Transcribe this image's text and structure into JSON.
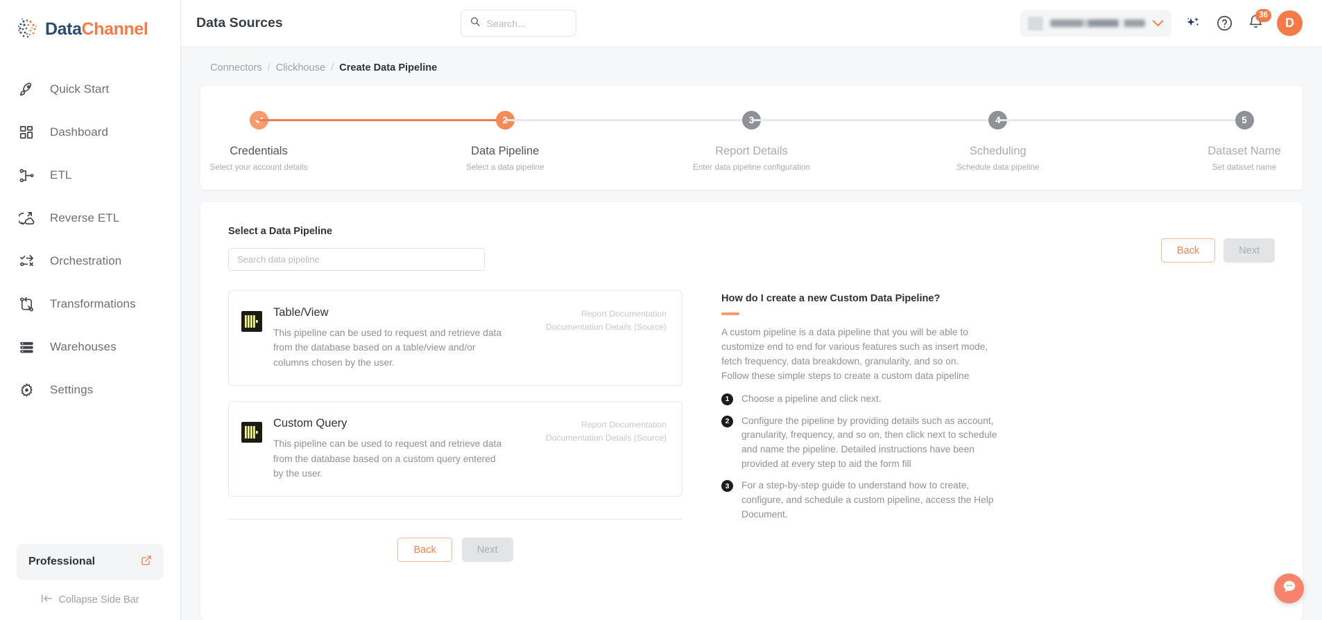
{
  "brand": {
    "name_first": "Data",
    "name_second": "Channel",
    "color_primary": "#f47b45",
    "color_dark": "#2b4a6f"
  },
  "sidebar": {
    "items": [
      {
        "label": "Quick Start",
        "icon": "rocket-icon"
      },
      {
        "label": "Dashboard",
        "icon": "grid-icon"
      },
      {
        "label": "ETL",
        "icon": "etl-icon"
      },
      {
        "label": "Reverse ETL",
        "icon": "reverse-etl-icon"
      },
      {
        "label": "Orchestration",
        "icon": "orchestration-icon"
      },
      {
        "label": "Transformations",
        "icon": "transformations-icon"
      },
      {
        "label": "Warehouses",
        "icon": "warehouses-icon"
      },
      {
        "label": "Settings",
        "icon": "gear-icon"
      }
    ],
    "plan": {
      "label": "Professional",
      "icon": "external-link-icon"
    },
    "collapse": {
      "label": "Collapse Side Bar",
      "icon": "collapse-left-icon"
    }
  },
  "header": {
    "title": "Data Sources",
    "search": {
      "placeholder": "Search...",
      "value": "",
      "icon": "search-icon"
    },
    "account": {
      "name": "",
      "redacted": true,
      "chevron": "chevron-down-icon"
    },
    "sparkle_icon": "sparkle-ai-icon",
    "help_icon": "help-circle-icon",
    "notifications": {
      "icon": "bell-icon",
      "count": "36"
    },
    "avatar": {
      "initial": "D"
    }
  },
  "breadcrumb": {
    "items": [
      "Connectors",
      "Clickhouse"
    ],
    "separator": "/",
    "current": "Create Data Pipeline"
  },
  "stepper": {
    "steps": [
      {
        "number": "1",
        "marker": "check",
        "state": "done",
        "title": "Credentials",
        "subtitle": "Select your account details"
      },
      {
        "number": "2",
        "marker": "2",
        "state": "active",
        "title": "Data Pipeline",
        "subtitle": "Select a data pipeline"
      },
      {
        "number": "3",
        "marker": "3",
        "state": "todo",
        "title": "Report Details",
        "subtitle": "Enter data pipeline configuration"
      },
      {
        "number": "4",
        "marker": "4",
        "state": "todo",
        "title": "Scheduling",
        "subtitle": "Schedule data pipeline"
      },
      {
        "number": "5",
        "marker": "5",
        "state": "todo",
        "title": "Dataset Name",
        "subtitle": "Set dataset name"
      }
    ]
  },
  "form": {
    "section_label": "Select a Data Pipeline",
    "search": {
      "placeholder": "Search data pipeline",
      "value": ""
    },
    "back_label": "Back",
    "next_label": "Next",
    "pipelines": [
      {
        "name": "Table/View",
        "description": "This pipeline can be used to request and retrieve data from the database based on a table/view and/or columns chosen by the user.",
        "doc_report": "Report Documentation",
        "doc_details": "Documentation Details (Source)",
        "icon": "clickhouse-icon"
      },
      {
        "name": "Custom Query",
        "description": "This pipeline can be used to request and retrieve data from the database based on a custom query entered by the user.",
        "doc_report": "Report Documentation",
        "doc_details": "Documentation Details (Source)",
        "icon": "clickhouse-icon"
      }
    ]
  },
  "help": {
    "title": "How do I create a new Custom Data Pipeline?",
    "paragraph": "A custom pipeline is a data pipeline that you will be able to customize end to end for various features such as insert mode, fetch frequency, data breakdown, granularity, and so on.\nFollow these simple steps to create a custom data pipeline",
    "steps": [
      {
        "num": "1",
        "text": "Choose a pipeline and click next."
      },
      {
        "num": "2",
        "text": "Configure the pipeline by providing details such as account, granularity, frequency, and so on, then click next to schedule and name the pipeline. Detailed instructions have been provided at every step to aid the form fill"
      },
      {
        "num": "3",
        "text": "For a step-by-step guide to understand how to create, configure, and schedule a custom pipeline, access the Help Document."
      }
    ]
  },
  "chat": {
    "icon": "chat-bubble-icon"
  }
}
